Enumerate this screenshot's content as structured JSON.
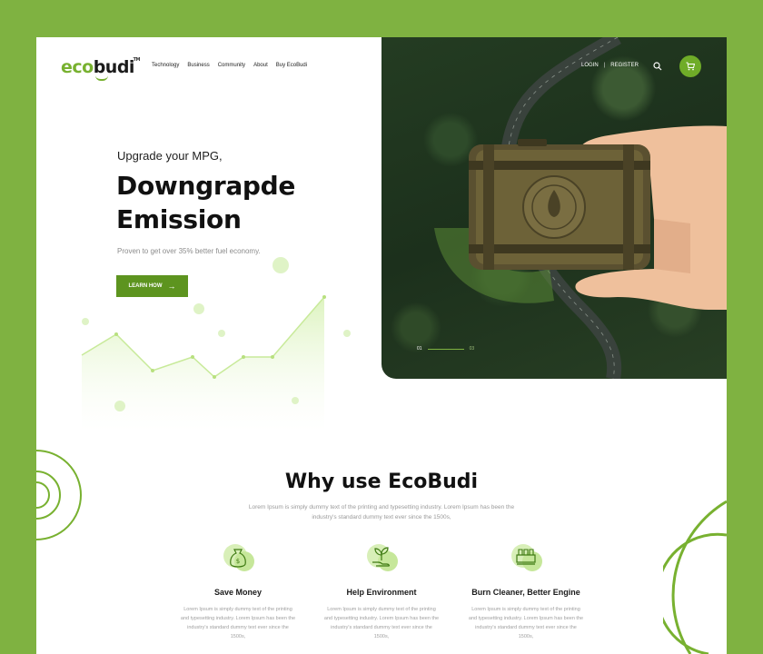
{
  "header": {
    "logo_eco": "eco",
    "logo_budi": "budi",
    "logo_tm": "TM",
    "nav": [
      "Technology",
      "Business",
      "Community",
      "About",
      "Buy EcoBudi"
    ],
    "login": "LOGIN",
    "separator": "|",
    "register": "REGISTER",
    "search_icon": "search-icon",
    "cart_icon": "cart-icon"
  },
  "hero": {
    "subtitle": "Upgrade your MPG,",
    "title_line1": "Downgrapde",
    "title_line2": "Emission",
    "description": "Proven to get over 35% better fuel economy.",
    "cta_label": "LEARN HOW",
    "slider_current": "01",
    "slider_next": "03"
  },
  "why": {
    "title": "Why use EcoBudi",
    "description": "Lorem Ipsum is simply dummy text of the printing and typesetting industry. Lorem Ipsum has been the industry's standard dummy text ever since the 1500s,",
    "features": [
      {
        "icon": "money-bag-icon",
        "title": "Save Money",
        "text": "Lorem Ipsum is simply dummy text of the printing and typesetting industry. Lorem Ipsum has been the industry's standard dummy text ever since the 1500s,"
      },
      {
        "icon": "plant-hand-icon",
        "title": "Help Environment",
        "text": "Lorem Ipsum is simply dummy text of the printing and typesetting industry. Lorem Ipsum has been the industry's standard dummy text ever since the 1500s,"
      },
      {
        "icon": "engine-icon",
        "title": "Burn Cleaner, Better Engine",
        "text": "Lorem Ipsum is simply dummy text of the printing and typesetting industry. Lorem Ipsum has been the industry's standard dummy text ever since the 1500s,"
      }
    ]
  },
  "colors": {
    "background": "#7fb241",
    "accent": "#78b130",
    "button": "#5d941f",
    "dark": "#111111"
  }
}
